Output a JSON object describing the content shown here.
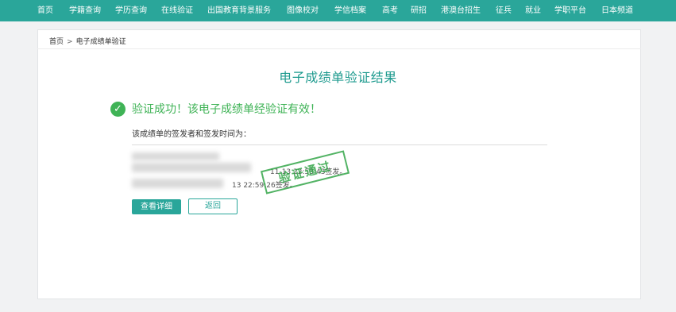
{
  "nav": {
    "items": [
      "首页",
      "学籍查询",
      "学历查询",
      "在线验证",
      "出国教育背景服务",
      "图像校对",
      "学信档案",
      "高考",
      "研招",
      "港澳台招生",
      "征兵",
      "就业",
      "学职平台",
      "日本频道"
    ]
  },
  "breadcrumb": {
    "home": "首页",
    "separator": ">",
    "current": "电子成绩单验证"
  },
  "page": {
    "title": "电子成绩单验证结果",
    "success_message": "验证成功！该电子成绩单经验证有效！",
    "signers_heading": "该成绩单的签发者和签发时间为：",
    "signer_line_1_visible": "11-13 22:53:43签发。",
    "signer_line_2_visible": "13 22:59:26签发。",
    "stamp_text": "验证通过"
  },
  "buttons": {
    "detail": "查看详细",
    "back": "返回"
  },
  "colors": {
    "nav_bg": "#2aa69a",
    "title": "#1f9b8f",
    "success": "#3fb356"
  }
}
